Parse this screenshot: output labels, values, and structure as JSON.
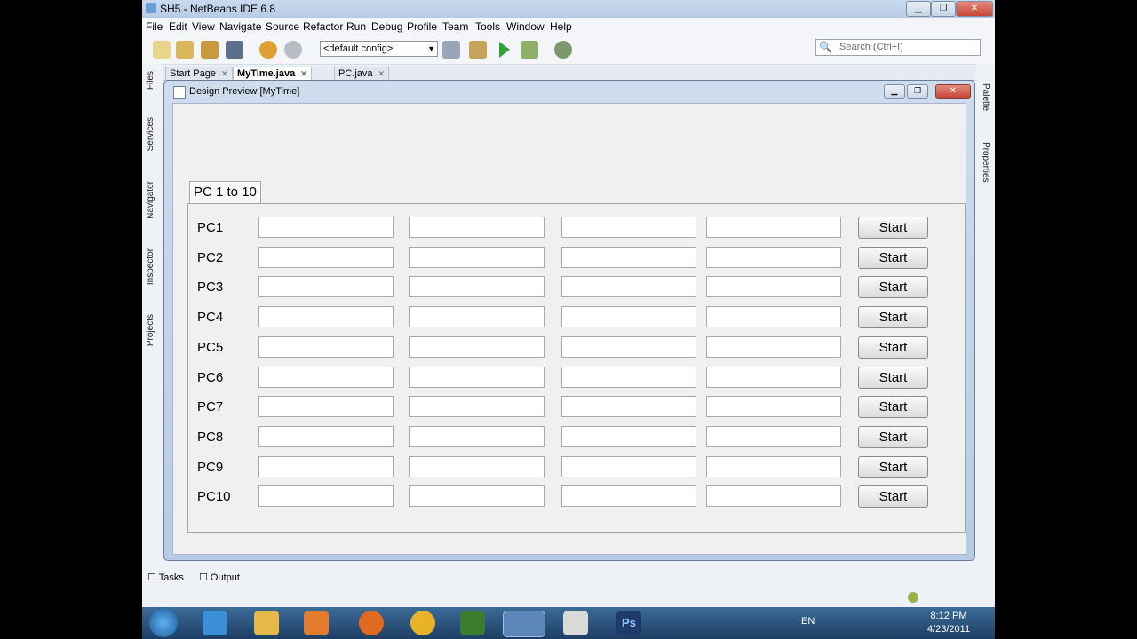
{
  "window": {
    "title": "SH5 - NetBeans IDE 6.8"
  },
  "menu": [
    "File",
    "Edit",
    "View",
    "Navigate",
    "Source",
    "Refactor",
    "Run",
    "Debug",
    "Profile",
    "Team",
    "Tools",
    "Window",
    "Help"
  ],
  "toolbar": {
    "config_value": "<default config>",
    "search_placeholder": "Search (Ctrl+I)"
  },
  "side_left": [
    "Files",
    "Services",
    "Navigator",
    "Inspector",
    "Projects"
  ],
  "side_right": [
    "Palette",
    "Properties"
  ],
  "editor_tabs": [
    {
      "label": "Start Page",
      "active": false
    },
    {
      "label": "MyTime.java",
      "active": true
    },
    {
      "label": "PC.java",
      "active": false
    }
  ],
  "preview": {
    "title": "Design Preview [MyTime]",
    "tab_label": "PC 1 to 10",
    "start_label": "Start",
    "rows": [
      "PC1",
      "PC2",
      "PC3",
      "PC4",
      "PC5",
      "PC6",
      "PC7",
      "PC8",
      "PC9",
      "PC10"
    ]
  },
  "bottom_tabs": [
    "Tasks",
    "Output"
  ],
  "taskbar": {
    "lang": "EN",
    "time": "8:12 PM",
    "date": "4/23/2011"
  }
}
